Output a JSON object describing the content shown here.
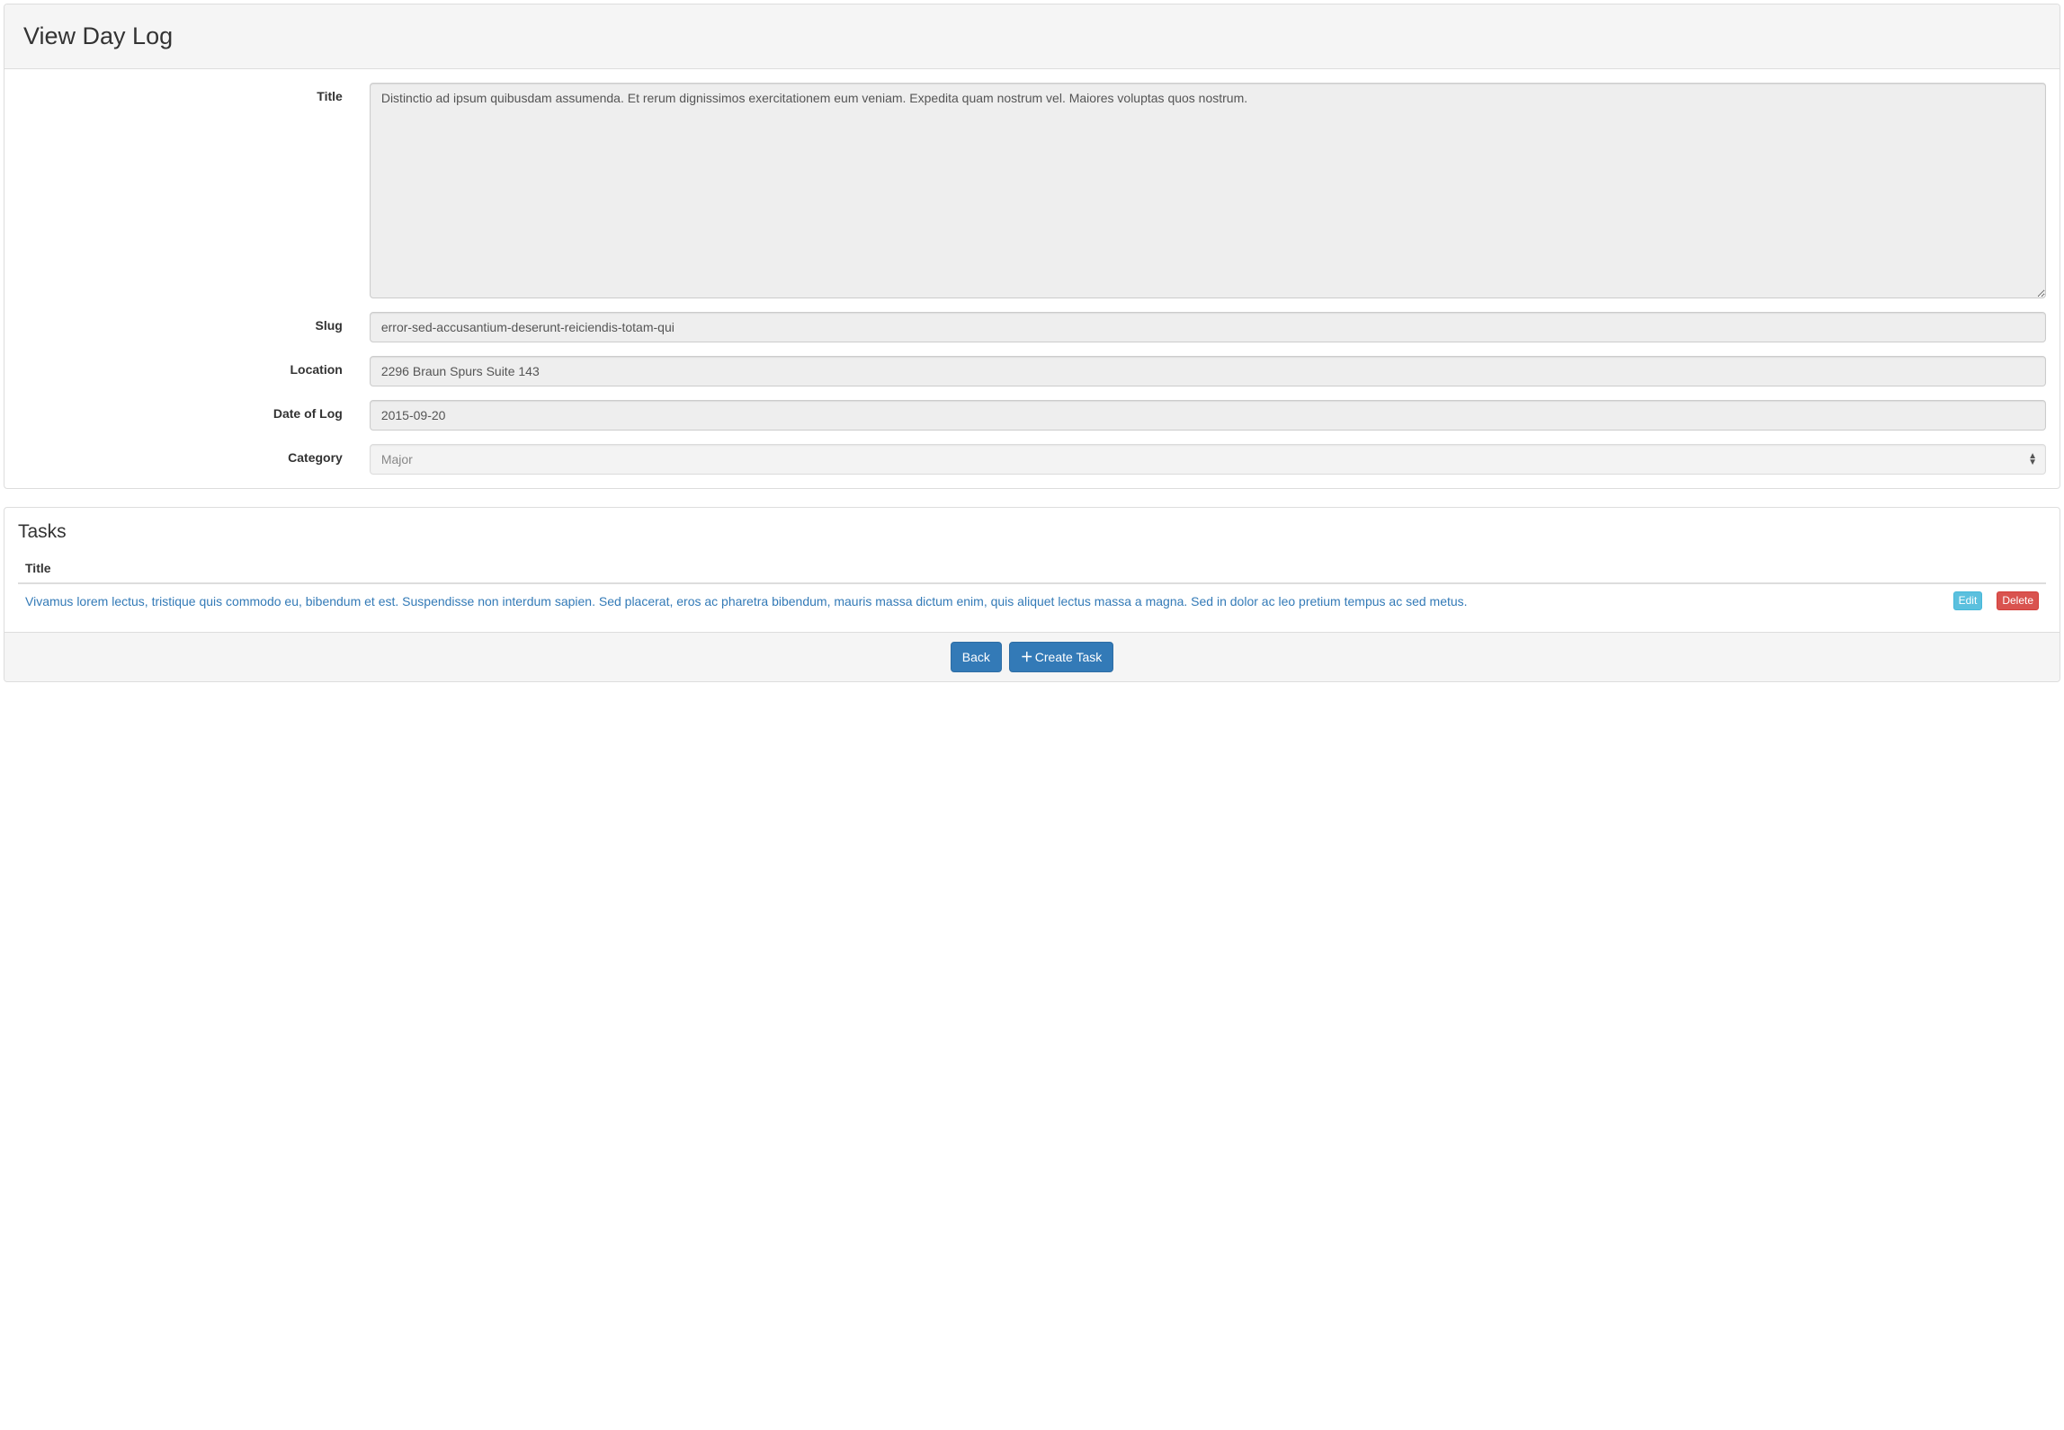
{
  "header": {
    "title": "View Day Log"
  },
  "form": {
    "labels": {
      "title": "Title",
      "slug": "Slug",
      "location": "Location",
      "date": "Date of Log",
      "category": "Category"
    },
    "values": {
      "title": "Distinctio ad ipsum quibusdam assumenda. Et rerum dignissimos exercitationem eum veniam. Expedita quam nostrum vel. Maiores voluptas quos nostrum.",
      "slug": "error-sed-accusantium-deserunt-reiciendis-totam-qui",
      "location": "2296 Braun Spurs Suite 143",
      "date": "2015-09-20",
      "category": "Major"
    }
  },
  "tasks": {
    "section_title": "Tasks",
    "columns": {
      "title": "Title"
    },
    "rows": [
      {
        "title": "Vivamus lorem lectus, tristique quis commodo eu, bibendum et est. Suspendisse non interdum sapien. Sed placerat, eros ac pharetra bibendum, mauris massa dictum enim, quis aliquet lectus massa a magna. Sed in dolor ac leo pretium tempus ac sed metus."
      }
    ],
    "actions": {
      "edit": "Edit",
      "delete": "Delete"
    }
  },
  "footer": {
    "back": "Back",
    "create": "Create Task"
  }
}
